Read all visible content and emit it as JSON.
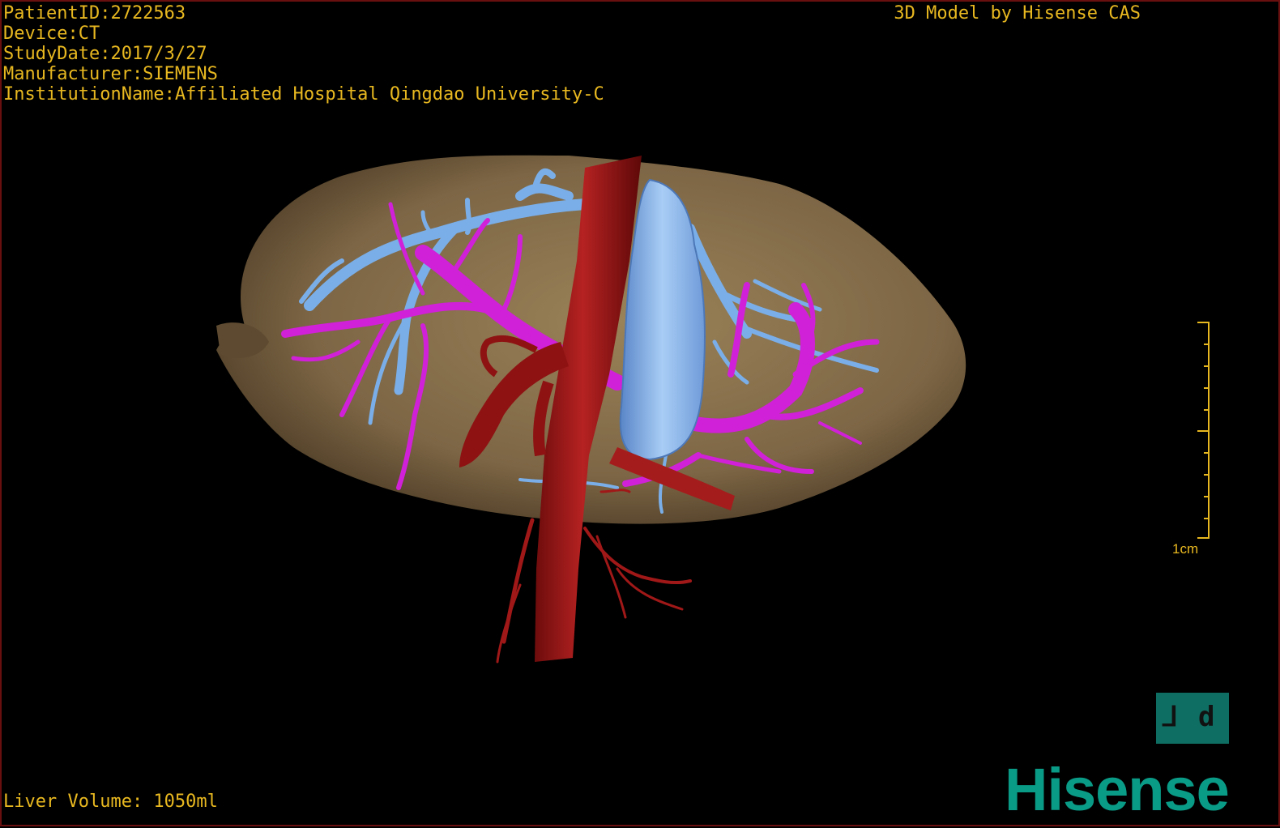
{
  "header": {
    "patient_id": "PatientID:2722563",
    "device": "Device:CT",
    "study_date": "StudyDate:2017/3/27",
    "manufacturer": "Manufacturer:SIEMENS",
    "institution": "InstitutionName:Affiliated Hospital Qingdao University-C"
  },
  "credit": "3D Model by Hisense CAS",
  "footer": {
    "volume": "Liver Volume: 1050ml"
  },
  "scale": {
    "label": "1cm"
  },
  "brand": {
    "logo_text": "Hisense",
    "button_left": "⅃",
    "button_right": "d"
  },
  "colors": {
    "text": "#e8b820",
    "liver": "#8a7450",
    "portal_vein": "#d020d8",
    "hepatic_vein": "#7aaee8",
    "artery": "#a01818",
    "brand": "#0a9b87"
  },
  "model_structures": [
    "liver",
    "portal-vein",
    "hepatic-vein",
    "vena-cava-artery"
  ]
}
